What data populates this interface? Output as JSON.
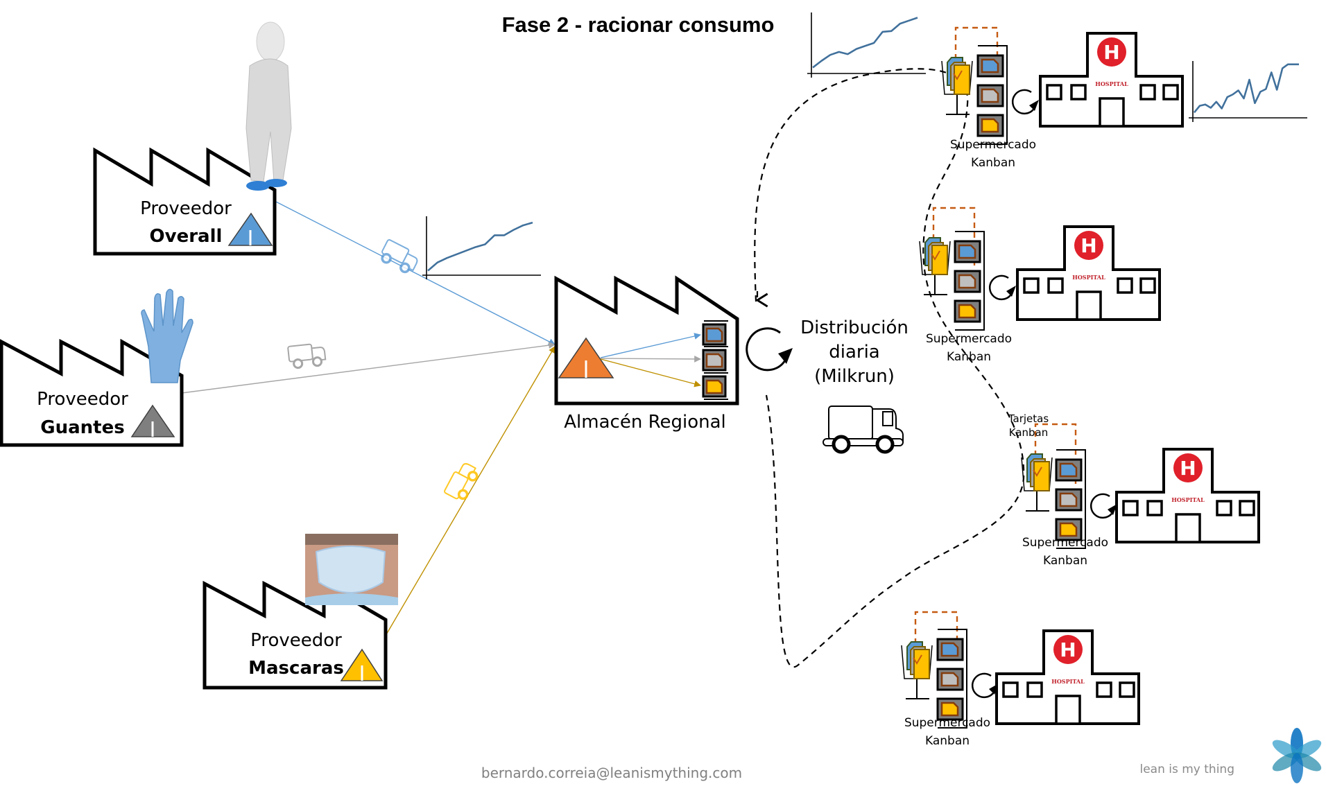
{
  "title": "Fase 2 -  racionar consumo",
  "colors": {
    "overall": "#5b9bd5",
    "guantes": "#7f7f7f",
    "mascaras": "#ffc000",
    "warehouse_inventory": "#ed7d31",
    "kanban_dash": "#c55a11",
    "hospital_red": "#e0202a",
    "trend_line": "#41719c"
  },
  "suppliers": [
    {
      "line1": "Proveedor",
      "line2": "Overall",
      "inventory_icon": "inventory-triangle",
      "product_image": "worker-in-overall"
    },
    {
      "line1": "Proveedor",
      "line2": "Guantes",
      "inventory_icon": "inventory-triangle",
      "product_image": "blue-glove"
    },
    {
      "line1": "Proveedor",
      "line2": "Mascaras",
      "inventory_icon": "inventory-triangle",
      "product_image": "surgical-mask-face"
    }
  ],
  "warehouse": {
    "label": "Almacén Regional",
    "inventory_letter": "I"
  },
  "distribution": {
    "line1": "Distribución",
    "line2": "diaria",
    "line3": "(Milkrun)"
  },
  "hospitals": [
    {
      "sign": "HOSPITAL",
      "letter": "H",
      "supermarket_line1": "Supermercado",
      "supermarket_line2": "Kanban"
    },
    {
      "sign": "HOSPITAL",
      "letter": "H",
      "supermarket_line1": "Supermercado",
      "supermarket_line2": "Kanban"
    },
    {
      "sign": "HOSPITAL",
      "letter": "H",
      "supermarket_line1": "Supermercado",
      "supermarket_line2": "Kanban",
      "cards_label_line1": "Tarjetas",
      "cards_label_line2": "Kanban"
    },
    {
      "sign": "HOSPITAL",
      "letter": "H",
      "supermarket_line1": "Supermercado",
      "supermarket_line2": "Kanban"
    }
  ],
  "footer": {
    "email": "bernardo.correia@leanismything.com",
    "brand": "lean is my thing"
  },
  "chart_data": [
    {
      "type": "line",
      "title": "",
      "xlabel": "",
      "ylabel": "",
      "location": "near-supplier-overall",
      "x": [
        1,
        2,
        3,
        4,
        5,
        6,
        7,
        8,
        9,
        10,
        11,
        12
      ],
      "values": [
        5,
        14,
        19,
        23,
        27,
        31,
        34,
        44,
        44,
        50,
        55,
        58
      ],
      "ylim": [
        0,
        65
      ]
    },
    {
      "type": "line",
      "title": "",
      "xlabel": "",
      "ylabel": "",
      "location": "top-center",
      "x": [
        1,
        2,
        3,
        4,
        5,
        6,
        7,
        8,
        9,
        10,
        11,
        12,
        13
      ],
      "values": [
        8,
        17,
        25,
        29,
        26,
        33,
        37,
        41,
        56,
        57,
        67,
        71,
        75
      ],
      "ylim": [
        0,
        82
      ]
    },
    {
      "type": "line",
      "title": "",
      "xlabel": "",
      "ylabel": "",
      "location": "top-right",
      "x": [
        1,
        2,
        3,
        4,
        5,
        6,
        7,
        8,
        9,
        10,
        11,
        12,
        13,
        14,
        15,
        16,
        17,
        18,
        19,
        20
      ],
      "values": [
        8,
        18,
        20,
        15,
        24,
        14,
        31,
        35,
        41,
        29,
        57,
        22,
        39,
        43,
        68,
        42,
        74,
        80,
        80,
        80
      ],
      "ylim": [
        0,
        85
      ]
    }
  ]
}
